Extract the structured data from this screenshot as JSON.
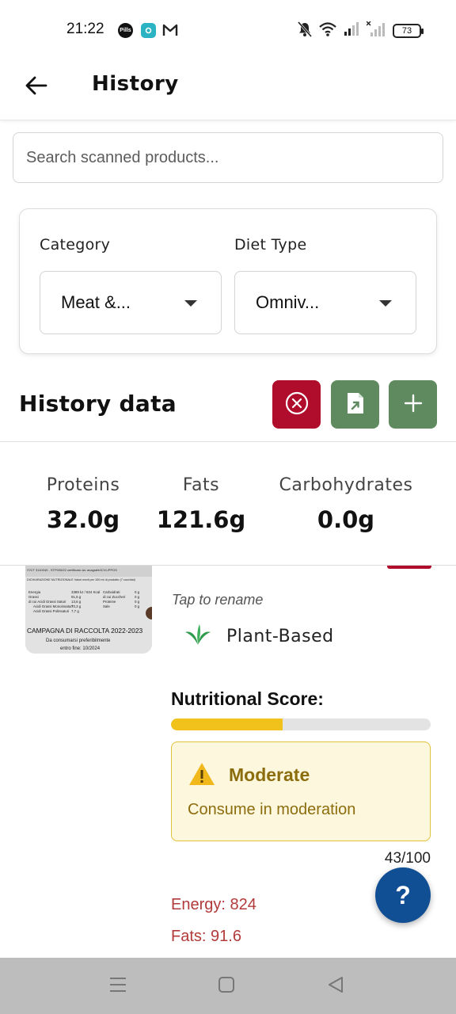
{
  "status_bar": {
    "time": "21:22",
    "app_icons": [
      "pills-app-icon",
      "maps-app-icon",
      "gmail-icon"
    ],
    "app_icon_text": "Pills",
    "battery": "73",
    "icons": [
      "mute-icon",
      "wifi-icon",
      "signal-icon",
      "signal-x-icon",
      "battery-icon"
    ]
  },
  "app_bar": {
    "title": "History",
    "back_icon": "arrow-left-icon"
  },
  "search": {
    "placeholder": "Search scanned products..."
  },
  "filters": {
    "category_label": "Category",
    "category_value": "Meat &...",
    "diet_label": "Diet Type",
    "diet_value": "Omniv..."
  },
  "history": {
    "title": "History data",
    "actions": [
      {
        "name": "clear",
        "icon": "close-circle-icon",
        "color": "#b00d2d"
      },
      {
        "name": "export",
        "icon": "file-export-icon",
        "color": "#5f8a5f"
      },
      {
        "name": "add",
        "icon": "plus-icon",
        "color": "#5f8a5f"
      }
    ]
  },
  "summary": {
    "proteins_label": "Proteins",
    "proteins_value": "32.0g",
    "fats_label": "Fats",
    "fats_value": "121.6g",
    "carbs_label": "Carbohydrates",
    "carbs_value": "0.0g"
  },
  "product": {
    "image_text": {
      "header": "IT/CT 3110049 - STP005/22 certificato da: anagrafe/ICVL/PPOS",
      "table_title": "DICHIARAZIONE NUTRIZIONALE Valori medi per 100 ml di prodotto (7 cucchiai)",
      "rows": [
        [
          "Energia",
          "3389 kJ / 824 Kcal",
          "Carboidrati",
          "0 g"
        ],
        [
          "Grassi",
          "91,6 g",
          "di cui Zuccheri",
          "0 g"
        ],
        [
          "di cui Acidi Grassi Saturi",
          "13,6 g",
          "Proteine",
          "0 g"
        ],
        [
          "Acidi Grassi Monoinsaturi",
          "70,3 g",
          "Sale",
          "0 g"
        ],
        [
          "Acidi Grassi Polinsaturi",
          "7,7 g",
          "",
          ""
        ]
      ],
      "campaign": "CAMPAGNA DI RACCOLTA 2022-2023",
      "consume": "Da consumarsi preferibilmente",
      "date": "entro fine: 10/2024"
    },
    "tap_to_rename": "Tap to rename",
    "diet_icon": "leaf-sprout-icon",
    "diet_label": "Plant-Based",
    "score_title": "Nutritional Score:",
    "score_fraction": 0.43,
    "score_level": "Moderate",
    "score_desc": "Consume in moderation",
    "score_number": "43/100",
    "energy": "Energy: 824",
    "fats": "Fats: 91.6",
    "accent_yellow": "#f0c21b",
    "accent_red": "#b00d2d"
  },
  "fab": {
    "label": "?"
  },
  "nav": {
    "icons": [
      "menu-icon",
      "home-square-icon",
      "back-triangle-icon"
    ]
  }
}
